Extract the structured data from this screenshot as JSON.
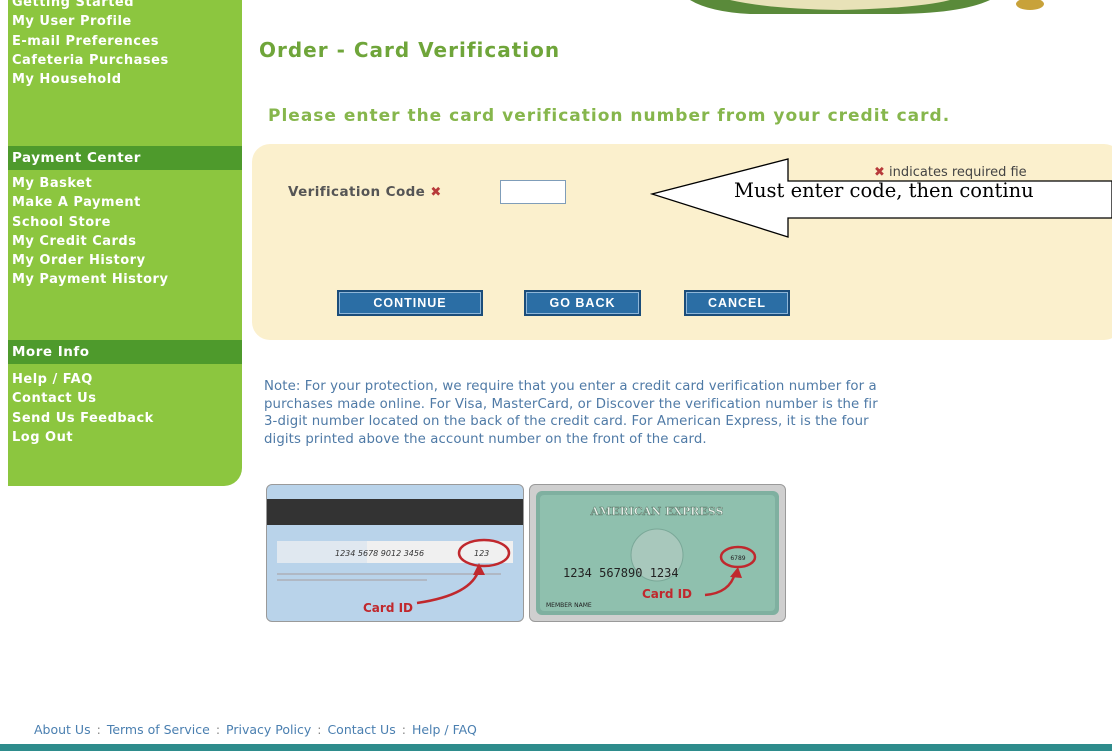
{
  "sidebar": {
    "group1": [
      "Getting Started",
      "My User Profile",
      "E-mail Preferences",
      "Cafeteria Purchases",
      "My Household"
    ],
    "payment_header": "Payment Center",
    "group2": [
      "My Basket",
      "Make A Payment",
      "School Store",
      "My Credit Cards",
      "My Order History",
      "My Payment History"
    ],
    "more_header": "More Info",
    "group3": [
      "Help / FAQ",
      "Contact Us",
      "Send Us Feedback",
      "Log Out"
    ]
  },
  "main": {
    "title": "Order - Card Verification",
    "instruction": "Please enter the card verification number from your credit card.",
    "required_note": "indicates required fie",
    "required_mark": "✖",
    "verification_label": "Verification Code",
    "verification_value": "",
    "buttons": {
      "continue": "CONTINUE",
      "go_back": "GO BACK",
      "cancel": "CANCEL"
    },
    "callout": "Must enter code, then continu",
    "note_lines": [
      "Note: For your protection, we require that you enter a credit card verification number for a",
      "purchases made online. For Visa, MasterCard, or Discover the verification number is the fir",
      "3-digit number located on the back of the credit card. For American Express, it is the four",
      "digits printed above the account number on the front of the card."
    ]
  },
  "cards": {
    "back": {
      "number": "1234 5678 9012 3456",
      "cvv": "123",
      "label": "Card ID"
    },
    "amex": {
      "brand": "AMERICAN EXPRESS",
      "number": "1234 567890 1234",
      "cid": "6789",
      "member": "MEMBER NAME",
      "label": "Card ID"
    }
  },
  "footer": {
    "links": [
      "About Us",
      "Terms of Service",
      "Privacy Policy",
      "Contact Us",
      "Help / FAQ"
    ],
    "separator": ":"
  },
  "colors": {
    "sidebar": "#8cc63f",
    "sidebar_header": "#4e9a2c",
    "panel": "#fbf0cd",
    "button": "#2b6ea5",
    "link": "#4a7fb0"
  },
  "icons": {
    "required": "required-x-icon",
    "callout": "callout-arrow-icon"
  }
}
